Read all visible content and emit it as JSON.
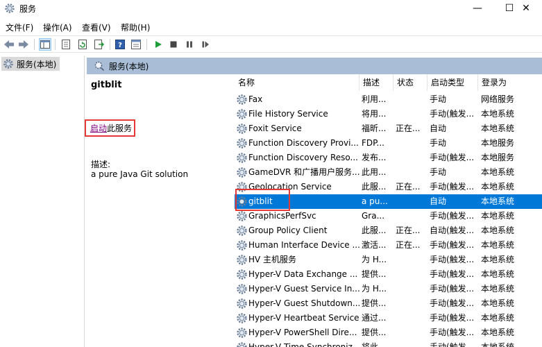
{
  "window": {
    "title": "服务",
    "controls": {
      "minimize": "—",
      "maximize": "☐",
      "close": "✕"
    }
  },
  "menu": [
    "文件(F)",
    "操作(A)",
    "查看(V)",
    "帮助(H)"
  ],
  "toolbar": {
    "icons": [
      "back-icon",
      "forward-icon",
      "show-hide-tree-icon",
      "properties-icon",
      "refresh-icon",
      "export-list-icon",
      "help-icon",
      "view-icon",
      "start-service-icon",
      "stop-service-icon",
      "pause-service-icon",
      "resume-service-icon"
    ]
  },
  "tree": {
    "root": "服务(本地)"
  },
  "pane": {
    "header": "服务(本地)"
  },
  "detail": {
    "service_name": "gitblit",
    "start_link": "启动",
    "start_suffix": "此服务",
    "desc_label": "描述:",
    "description": "a pure Java Git solution"
  },
  "table": {
    "columns": [
      "名称",
      "描述",
      "状态",
      "启动类型",
      "登录为"
    ],
    "sort_indicator": "^",
    "rows": [
      {
        "name": "Fax",
        "desc": "利用...",
        "status": "",
        "start": "手动",
        "logon": "网络服务"
      },
      {
        "name": "File History Service",
        "desc": "将用...",
        "status": "",
        "start": "手动(触发...",
        "logon": "本地系统"
      },
      {
        "name": "Foxit Service",
        "desc": "福昕...",
        "status": "正在...",
        "start": "自动",
        "logon": "本地系统"
      },
      {
        "name": "Function Discovery Provi...",
        "desc": "FDP...",
        "status": "",
        "start": "手动",
        "logon": "本地服务"
      },
      {
        "name": "Function Discovery Reso...",
        "desc": "发布...",
        "status": "",
        "start": "手动(触发...",
        "logon": "本地服务"
      },
      {
        "name": "GameDVR 和广播用户服务...",
        "desc": "此用...",
        "status": "",
        "start": "手动",
        "logon": "本地系统"
      },
      {
        "name": "Geolocation Service",
        "desc": "此服...",
        "status": "正在...",
        "start": "手动(触发...",
        "logon": "本地系统"
      },
      {
        "name": "gitblit",
        "desc": "a pu...",
        "status": "",
        "start": "自动",
        "logon": "本地系统",
        "selected": true
      },
      {
        "name": "GraphicsPerfSvc",
        "desc": "Gra...",
        "status": "",
        "start": "手动(触发...",
        "logon": "本地系统"
      },
      {
        "name": "Group Policy Client",
        "desc": "此服...",
        "status": "正在...",
        "start": "自动(触发...",
        "logon": "本地系统"
      },
      {
        "name": "Human Interface Device ...",
        "desc": "激活...",
        "status": "正在...",
        "start": "手动(触发...",
        "logon": "本地系统"
      },
      {
        "name": "HV 主机服务",
        "desc": "为 H...",
        "status": "",
        "start": "手动(触发...",
        "logon": "本地系统"
      },
      {
        "name": "Hyper-V Data Exchange ...",
        "desc": "提供...",
        "status": "",
        "start": "手动(触发...",
        "logon": "本地系统"
      },
      {
        "name": "Hyper-V Guest Service In...",
        "desc": "为 H...",
        "status": "",
        "start": "手动(触发...",
        "logon": "本地系统"
      },
      {
        "name": "Hyper-V Guest Shutdown...",
        "desc": "提供...",
        "status": "",
        "start": "手动(触发...",
        "logon": "本地系统"
      },
      {
        "name": "Hyper-V Heartbeat Service",
        "desc": "通过...",
        "status": "",
        "start": "手动(触发...",
        "logon": "本地系统"
      },
      {
        "name": "Hyper-V PowerShell Dire...",
        "desc": "提供...",
        "status": "",
        "start": "手动(触发...",
        "logon": "本地系统"
      },
      {
        "name": "Hyper-V Time Synchroniz...",
        "desc": "将此...",
        "status": "",
        "start": "手动(触发...",
        "logon": "本地系统"
      }
    ]
  },
  "colors": {
    "selection": "#0078d7",
    "pane_header": "#a9bed6",
    "highlight_box": "#e53935",
    "link": "#800080"
  }
}
